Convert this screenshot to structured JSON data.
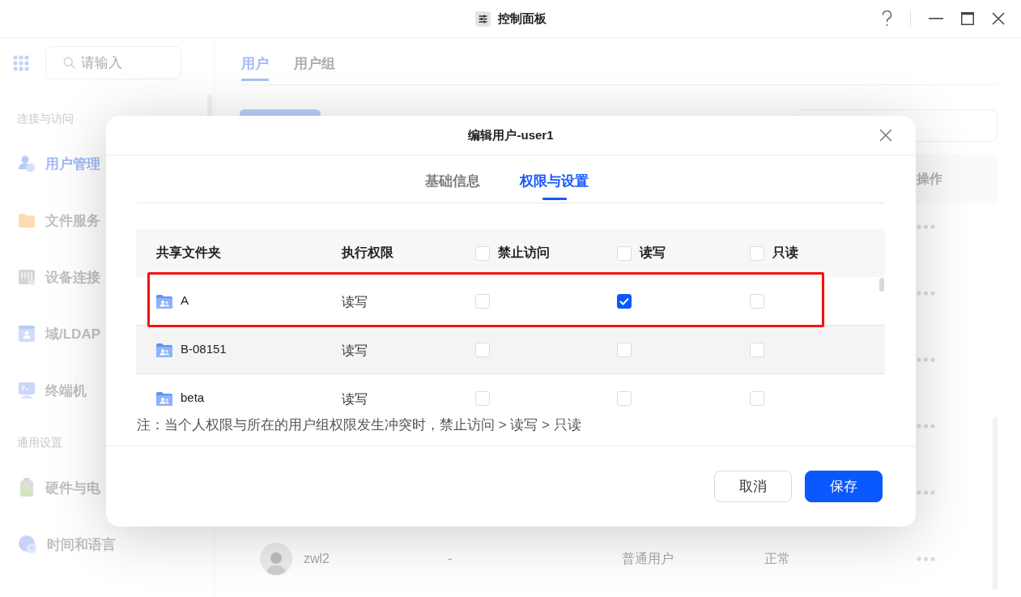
{
  "window": {
    "title": "控制面板"
  },
  "sidebar": {
    "search": {
      "placeholder": "请输入"
    },
    "sections": [
      {
        "label": "连接与访问",
        "items": [
          {
            "label": "用户管理",
            "selected": true
          },
          {
            "label": "文件服务",
            "selected": false
          },
          {
            "label": "设备连接",
            "selected": false
          },
          {
            "label": "域/LDAP",
            "selected": false
          },
          {
            "label": "终端机",
            "selected": false
          }
        ]
      },
      {
        "label": "通用设置",
        "items": [
          {
            "label": "硬件与电",
            "selected": false
          },
          {
            "label": "时间和语言",
            "selected": false
          }
        ]
      }
    ]
  },
  "main": {
    "tabs": [
      {
        "label": "用户",
        "selected": true
      },
      {
        "label": "用户组",
        "selected": false
      }
    ],
    "table": {
      "columns": [
        {
          "label": "操作"
        }
      ],
      "rows": [
        {
          "kind": "covered"
        },
        {
          "kind": "covered"
        },
        {
          "kind": "covered"
        },
        {
          "kind": "covered"
        },
        {
          "kind": "covered"
        },
        {
          "kind": "user",
          "name": "zwl2",
          "column_2": "-",
          "column_3": "普通用户",
          "column_4": "正常"
        }
      ]
    }
  },
  "dialog": {
    "title": "编辑用户-user1",
    "tabs": [
      {
        "label": "基础信息",
        "selected": false
      },
      {
        "label": "权限与设置",
        "selected": true
      }
    ],
    "table": {
      "columns": [
        {
          "label": "共享文件夹",
          "kind": "text"
        },
        {
          "label": "执行权限",
          "kind": "text"
        },
        {
          "label": "禁止访问",
          "kind": "checkbox",
          "checked": false
        },
        {
          "label": "读写",
          "kind": "checkbox",
          "checked": false
        },
        {
          "label": "只读",
          "kind": "checkbox",
          "checked": false
        }
      ],
      "rows": [
        {
          "folder": "A",
          "execute_permission": "读写",
          "options": [
            {
              "checked": false
            },
            {
              "checked": true
            },
            {
              "checked": false
            }
          ],
          "outlined": true,
          "hovered": false
        },
        {
          "folder": "B-08151",
          "execute_permission": "读写",
          "options": [
            {
              "checked": false
            },
            {
              "checked": false
            },
            {
              "checked": false
            }
          ],
          "outlined": false,
          "hovered": true
        },
        {
          "folder": "beta",
          "execute_permission": "读写",
          "options": [
            {
              "checked": false
            },
            {
              "checked": false
            },
            {
              "checked": false
            }
          ],
          "outlined": false,
          "hovered": false
        }
      ]
    },
    "note": "注：当个人权限与所在的用户组权限发生冲突时，禁止访问 > 读写 > 只读",
    "buttons": [
      {
        "label": "取消",
        "kind": "secondary"
      },
      {
        "label": "保存",
        "kind": "primary"
      }
    ]
  }
}
